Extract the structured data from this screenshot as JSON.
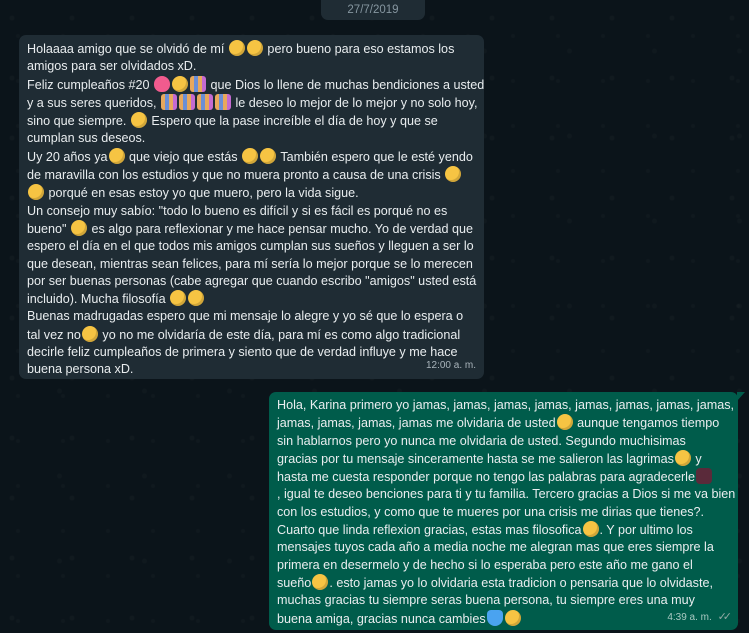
{
  "date_chip": "27/7/2019",
  "incoming": {
    "lines": [
      [
        "Holaaaa amigo que se olvidó de mí ",
        "e:yellow",
        "e:yellow",
        " pero bueno para eso estamos los"
      ],
      [
        "amigos para ser olvidados xD."
      ],
      [
        "Feliz cumpleaños #20 ",
        "e:pink",
        "e:yellow",
        "e:people",
        " que Dios lo llene de muchas bendiciones a usted"
      ],
      [
        "y a sus seres queridos, ",
        "e:people",
        "e:people",
        "e:people",
        "e:people",
        " le deseo lo mejor de lo mejor y no solo hoy,"
      ],
      [
        "sino que siempre. ",
        "e:yellow",
        " Espero que la pase increíble el día de hoy y que se"
      ],
      [
        "cumplan sus deseos."
      ],
      [
        "Uy 20 años ya",
        "e:yellow",
        " que viejo que estás ",
        "e:yellow",
        "e:yellow",
        " También espero que le esté yendo"
      ],
      [
        "de maravilla con los estudios y que no muera pronto a causa de una crisis ",
        "e:yellow"
      ],
      [
        "e:yellow",
        " porqué en esas estoy yo que muero, pero la vida sigue."
      ],
      [
        "Un consejo muy sabío: \"todo lo bueno es difícil y si es fácil es porqué no es"
      ],
      [
        "bueno\" ",
        "e:yellow",
        " es algo para reflexionar y me hace pensar mucho. Yo de verdad que"
      ],
      [
        "espero el día en el que todos mis amigos cumplan sus sueños y lleguen a ser lo"
      ],
      [
        "que desean, mientras sean felices, para mí sería lo mejor porque se lo merecen"
      ],
      [
        "por ser buenas personas (cabe agregar que cuando escribo \"amigos\" usted está"
      ],
      [
        "incluido). Mucha filosofía ",
        "e:yellow",
        "e:yellow"
      ],
      [
        "Buenas madrugadas espero que mi mensaje lo alegre y yo sé que lo espera o"
      ],
      [
        "tal vez no",
        "e:yellow",
        " yo no me olvidaría de este día, para mí es como algo tradicional"
      ],
      [
        "decirle feliz cumpleaños de primera y siento que de verdad influye y me hace"
      ],
      [
        "buena persona xD."
      ]
    ],
    "time": "12:00 a. m."
  },
  "outgoing": {
    "lines": [
      [
        "Hola, Karina primero yo jamas, jamas, jamas, jamas, jamas, jamas, jamas, jamas,"
      ],
      [
        "jamas, jamas, jamas, jamas me olvidaria de usted",
        "e:yellow",
        " aunque tengamos tiempo"
      ],
      [
        "sin hablarnos pero yo nunca me olvidaria de usted. Segundo muchisimas"
      ],
      [
        "gracias por tu mensaje sinceramente hasta se me salieron las lagrimas",
        "e:yellow",
        " y"
      ],
      [
        "hasta me cuesta responder porque no tengo las palabras para agradecerle",
        "e:dark"
      ],
      [
        ", igual te deseo benciones para ti y tu familia. Tercero gracias a Dios si me va bien"
      ],
      [
        "con los estudios, y como que te mueres por una crisis me dirias que tienes?."
      ],
      [
        "Cuarto que linda reflexion gracias, estas mas filosofica",
        "e:yellow",
        ". Y por ultimo los"
      ],
      [
        "mensajes tuyos cada año a media noche me alegran mas que eres siempre la"
      ],
      [
        "primera en desermelo y de hecho si lo esperaba pero este año me gano el"
      ],
      [
        "sueño",
        "e:yellow",
        ". esto jamas yo lo olvidaria esta tradicion o pensaria que lo olvidaste,"
      ],
      [
        "muchas gracias tu siempre seras buena persona, tu siempre eres una muy"
      ],
      [
        "buena amiga, gracias nunca cambies",
        "e:heart",
        "e:yellow"
      ]
    ],
    "time": "4:39 a. m.",
    "ticks": "✓✓"
  }
}
